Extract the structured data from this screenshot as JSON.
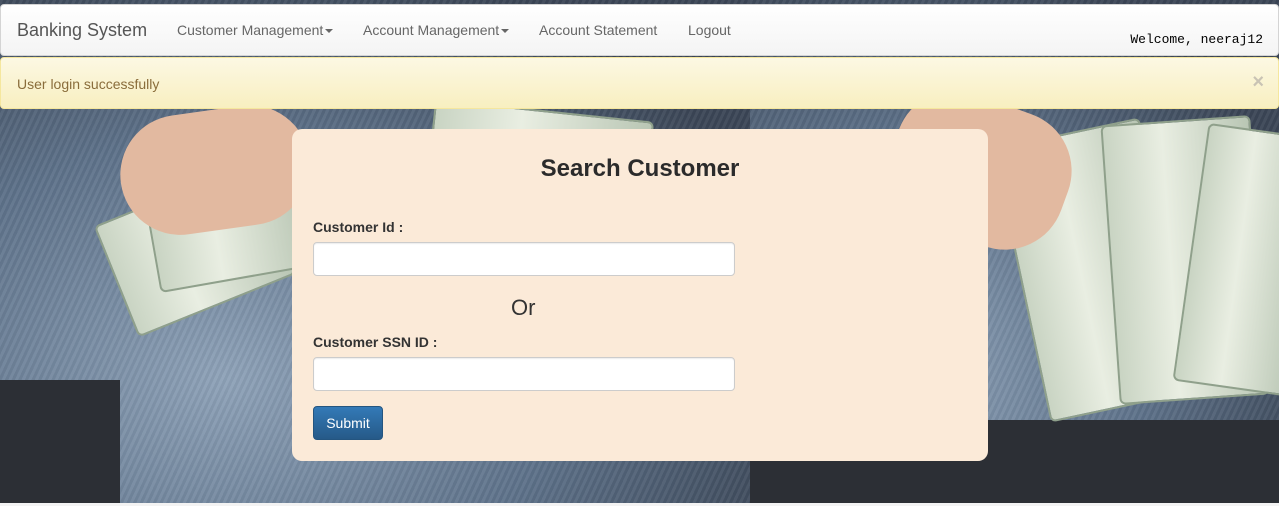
{
  "navbar": {
    "brand": "Banking System",
    "items": [
      {
        "label": "Customer Management",
        "dropdown": true
      },
      {
        "label": "Account Management",
        "dropdown": true
      },
      {
        "label": "Account Statement",
        "dropdown": false
      },
      {
        "label": "Logout",
        "dropdown": false
      }
    ],
    "welcome": "Welcome, neeraj12"
  },
  "alert": {
    "message": "User login successfully",
    "close": "×"
  },
  "form": {
    "title": "Search Customer",
    "customer_id_label": "Customer Id :",
    "customer_id_value": "",
    "or_text": "Or",
    "ssn_label": "Customer SSN ID :",
    "ssn_value": "",
    "submit_label": "Submit"
  },
  "colors": {
    "card_bg": "#fbead8",
    "alert_text": "#8a6d3b",
    "button": "#337ab7"
  }
}
